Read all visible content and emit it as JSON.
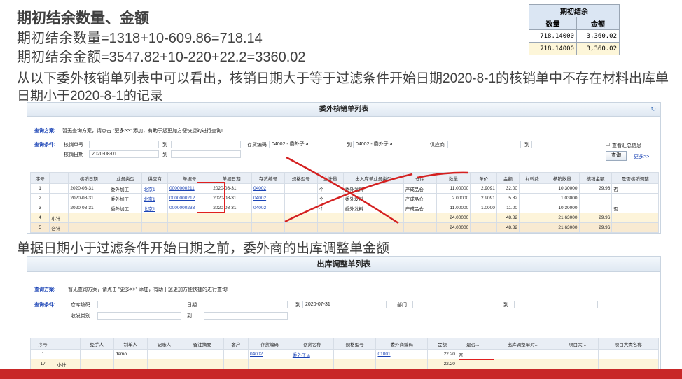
{
  "slide": {
    "heading": "期初结余数量、金额",
    "line1": "期初结余数量=1318+10-609.86=718.14",
    "line2": "期初结余金额=3547.82+10-220+22.2=3360.02",
    "para": "从以下委外核销单列表中可以看出，核销日期大于等于过滤条件开始日期2020-8-1的核销单中不存在材料出库单日期小于2020-8-1的记录",
    "para2": "单据日期小于过滤条件开始日期之前，委外商的出库调整单金额"
  },
  "summary": {
    "title": "期初结余",
    "col1": "数量",
    "col2": "金额",
    "row1": [
      "718.14000",
      "3,360.02"
    ],
    "row2": [
      "718.14000",
      "3,360.02"
    ]
  },
  "w1": {
    "title": "委外核销单列表",
    "scheme_label": "查询方案:",
    "scheme_hint": "暂无查询方案，请点击 \"更多>>\" 添加，有助于您更加方便快捷的进行查询!",
    "cond_label": "查询条件:",
    "f_billno": "核销单号",
    "f_date": "核销日期",
    "date_value": "2020-08-01",
    "to": "到",
    "f_inv": "存货编码",
    "inv_from": "04002 - 委外子.a",
    "inv_to": "04002 - 委外子.a",
    "f_vendor": "供应商",
    "chk_sum": "查看汇总信息",
    "btn_query": "查询",
    "more": "更多>>",
    "headers": [
      "序号",
      "",
      "核销日期",
      "业务类型",
      "供应商",
      "单据号",
      "单据日期",
      "存货编号",
      "规格型号",
      "主计量",
      "出入库单业务类型",
      "仓库",
      "数量",
      "单价",
      "金额",
      "材料费",
      "核销数量",
      "核销金额",
      "是否核销调整"
    ],
    "rows": [
      [
        "1",
        "",
        "2020-08-31",
        "委外加工",
        "北京1",
        "0000000211",
        "2020-08-31",
        "04002",
        "",
        "个",
        "委外发料",
        "产成品仓",
        "11.00000",
        "2.9091",
        "32.00",
        "",
        "10.30000",
        "29.96",
        "否"
      ],
      [
        "2",
        "",
        "2020-08-31",
        "委外加工",
        "北京1",
        "0000000212",
        "2020-08-31",
        "04002",
        "",
        "个",
        "委外发料",
        "产成品仓",
        "2.00000",
        "2.9091",
        "5.82",
        "",
        "1.03000",
        "",
        ""
      ],
      [
        "3",
        "",
        "2020-08-31",
        "委外加工",
        "北京1",
        "0000000233",
        "2020-08-31",
        "04002",
        "",
        "个",
        "委外发料",
        "产成品仓",
        "11.00000",
        "1.0000",
        "11.00",
        "",
        "10.30000",
        "",
        "否"
      ],
      [
        "4",
        "小计",
        "",
        "",
        "",
        "",
        "",
        "",
        "",
        "",
        "",
        "",
        "24.00000",
        "",
        "48.82",
        "",
        "21.63000",
        "29.96",
        ""
      ],
      [
        "5",
        "合计",
        "",
        "",
        "",
        "",
        "",
        "",
        "",
        "",
        "",
        "",
        "24.00000",
        "",
        "48.82",
        "",
        "21.63000",
        "29.96",
        ""
      ]
    ]
  },
  "w2": {
    "title": "出库调整单列表",
    "scheme_label": "查询方案:",
    "scheme_hint": "暂无查询方案，请点击 \"更多>>\" 添加，有助于您更加方便快捷的进行查询!",
    "cond_label": "查询条件:",
    "f_wh": "仓库编码",
    "f_date": "日期",
    "to": "到",
    "date_to": "2020-07-31",
    "f_dept": "部门",
    "f_recv": "收发类别",
    "headers": [
      "序号",
      "",
      "经手人",
      "制单人",
      "记账人",
      "备注摘要",
      "客户",
      "存货编码",
      "存货名称",
      "规格型号",
      "委外商编码",
      "金额",
      "是否...",
      "出库调整单对...",
      "项目大...",
      "项目大类名称"
    ],
    "rows": [
      [
        "1",
        "",
        "",
        "demo",
        "",
        "",
        "",
        "04002",
        "委外子.a",
        "",
        "01001",
        "22.20",
        "否",
        "",
        "",
        ""
      ],
      [
        "17",
        "小计",
        "",
        "",
        "",
        "",
        "",
        "",
        "",
        "",
        "",
        "22.20",
        "",
        "",
        "",
        ""
      ]
    ]
  }
}
